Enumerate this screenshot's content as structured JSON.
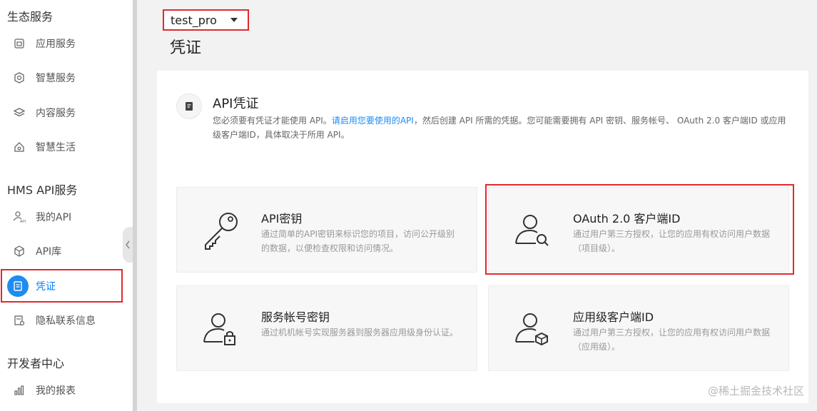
{
  "sidebar": {
    "sections": [
      {
        "title": "生态服务"
      },
      {
        "title": "HMS API服务"
      },
      {
        "title": "开发者中心"
      }
    ],
    "items": [
      {
        "label": "应用服务",
        "icon": "app-service-icon"
      },
      {
        "label": "智慧服务",
        "icon": "smart-service-icon"
      },
      {
        "label": "内容服务",
        "icon": "content-service-icon"
      },
      {
        "label": "智慧生活",
        "icon": "smart-life-icon"
      },
      {
        "label": "我的API",
        "icon": "my-api-icon"
      },
      {
        "label": "API库",
        "icon": "api-library-icon"
      },
      {
        "label": "凭证",
        "icon": "credential-icon",
        "active": true
      },
      {
        "label": "隐私联系信息",
        "icon": "privacy-contact-icon"
      },
      {
        "label": "我的报表",
        "icon": "report-icon"
      }
    ]
  },
  "header": {
    "project_select": "test_pro",
    "page_title": "凭证"
  },
  "api_section": {
    "title": "API凭证",
    "desc_part1": "您必须要有凭证才能使用 API。",
    "desc_link": "请启用您要使用的API",
    "desc_part2": "，然后创建 API 所需的凭据。您可能需要拥有 API 密钥、服务帐号、 OAuth 2.0 客户端ID 或应用级客户端ID，具体取决于所用 API。"
  },
  "cards": [
    {
      "title": "API密钥",
      "desc": "通过简单的API密钥来标识您的项目，访问公开级别的数据，以便检查权限和访问情况。",
      "icon": "key-icon"
    },
    {
      "title": "OAuth 2.0 客户端ID",
      "desc": "通过用户第三方授权，让您的应用有权访问用户数据（项目级）。",
      "icon": "user-search-icon"
    },
    {
      "title": "服务帐号密钥",
      "desc": "通过机机帐号实现服务器到服务器应用级身份认证。",
      "icon": "user-lock-icon"
    },
    {
      "title": "应用级客户端ID",
      "desc": "通过用户第三方授权，让您的应用有权访问用户数据（应用级）。",
      "icon": "user-box-icon"
    }
  ],
  "watermark": "@稀土掘金技术社区",
  "colors": {
    "accent": "#1e8cf0",
    "highlight": "#e0292f"
  }
}
